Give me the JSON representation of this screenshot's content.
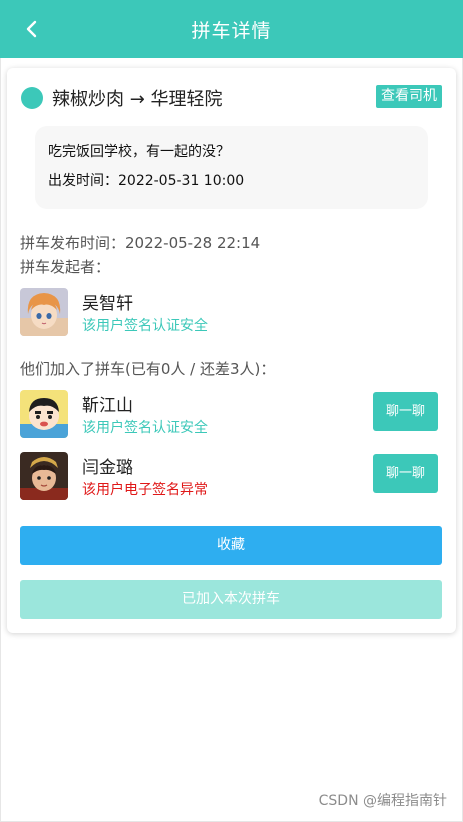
{
  "header": {
    "title": "拼车详情",
    "back_icon": "chevron-left-icon"
  },
  "trip": {
    "route": "辣椒炒肉 → 华理轻院",
    "view_driver_label": "查看司机",
    "note": "吃完饭回学校，有一起的没？",
    "departure": "出发时间：2022-05-31 10:00",
    "published": "拼车发布时间：2022-05-28 22:14",
    "initiator_label": "拼车发起者："
  },
  "initiator": {
    "name": "吴智轩",
    "signature": "该用户签名认证安全",
    "signature_status": "safe"
  },
  "members_heading": "他们加入了拼车(已有0人 / 还差3人)：",
  "members": [
    {
      "name": "靳江山",
      "signature": "该用户签名认证安全",
      "signature_status": "safe",
      "chat_label": "聊一聊"
    },
    {
      "name": "闫金璐",
      "signature": "该用户电子签名异常",
      "signature_status": "abnormal",
      "chat_label": "聊一聊"
    }
  ],
  "actions": {
    "favorite_label": "收藏",
    "joined_label": "已加入本次拼车"
  },
  "watermark": "CSDN @编程指南针",
  "colors": {
    "accent": "#3cc8b9",
    "favorite": "#2eaef0",
    "joined": "#9be6dc",
    "danger": "#e01818"
  }
}
